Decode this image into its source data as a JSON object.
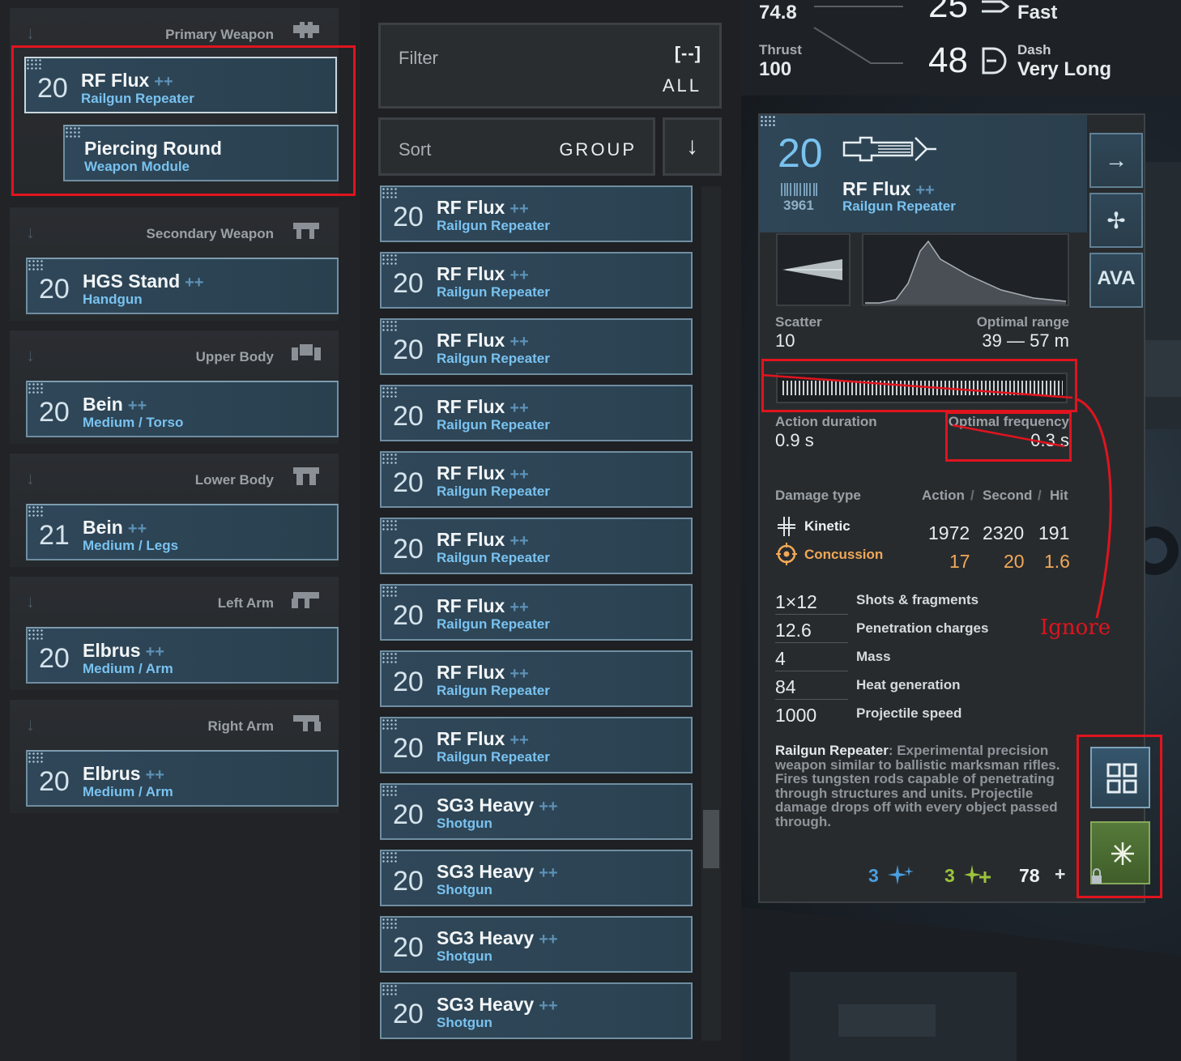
{
  "loadout": [
    {
      "slot": "Primary Weapon",
      "cards": [
        {
          "level": "20",
          "name": "RF Flux",
          "mod": "++",
          "type": "Railgun Repeater"
        },
        {
          "level": "",
          "name": "Piercing Round",
          "mod": "",
          "type": "Weapon Module"
        }
      ]
    },
    {
      "slot": "Secondary Weapon",
      "cards": [
        {
          "level": "20",
          "name": "HGS Stand",
          "mod": "++",
          "type": "Handgun"
        }
      ]
    },
    {
      "slot": "Upper Body",
      "cards": [
        {
          "level": "20",
          "name": "Bein",
          "mod": "++",
          "type": "Medium / Torso"
        }
      ]
    },
    {
      "slot": "Lower Body",
      "cards": [
        {
          "level": "21",
          "name": "Bein",
          "mod": "++",
          "type": "Medium / Legs"
        }
      ]
    },
    {
      "slot": "Left Arm",
      "cards": [
        {
          "level": "20",
          "name": "Elbrus",
          "mod": "++",
          "type": "Medium / Arm"
        }
      ]
    },
    {
      "slot": "Right Arm",
      "cards": [
        {
          "level": "20",
          "name": "Elbrus",
          "mod": "++",
          "type": "Medium / Arm"
        }
      ]
    }
  ],
  "filter": {
    "label": "Filter",
    "icon": "[--]",
    "value": "ALL"
  },
  "sort": {
    "label": "Sort",
    "value": "GROUP",
    "direction_icon": "↓"
  },
  "item_list": [
    {
      "level": "20",
      "name": "RF Flux",
      "mod": "++",
      "type": "Railgun Repeater"
    },
    {
      "level": "20",
      "name": "RF Flux",
      "mod": "++",
      "type": "Railgun Repeater"
    },
    {
      "level": "20",
      "name": "RF Flux",
      "mod": "++",
      "type": "Railgun Repeater"
    },
    {
      "level": "20",
      "name": "RF Flux",
      "mod": "++",
      "type": "Railgun Repeater"
    },
    {
      "level": "20",
      "name": "RF Flux",
      "mod": "++",
      "type": "Railgun Repeater"
    },
    {
      "level": "20",
      "name": "RF Flux",
      "mod": "++",
      "type": "Railgun Repeater"
    },
    {
      "level": "20",
      "name": "RF Flux",
      "mod": "++",
      "type": "Railgun Repeater"
    },
    {
      "level": "20",
      "name": "RF Flux",
      "mod": "++",
      "type": "Railgun Repeater"
    },
    {
      "level": "20",
      "name": "RF Flux",
      "mod": "++",
      "type": "Railgun Repeater"
    },
    {
      "level": "20",
      "name": "SG3 Heavy",
      "mod": "++",
      "type": "Shotgun"
    },
    {
      "level": "20",
      "name": "SG3 Heavy",
      "mod": "++",
      "type": "Shotgun"
    },
    {
      "level": "20",
      "name": "SG3 Heavy",
      "mod": "++",
      "type": "Shotgun"
    },
    {
      "level": "20",
      "name": "SG3 Heavy",
      "mod": "++",
      "type": "Shotgun"
    }
  ],
  "mech_stats": {
    "top_left_value": "74.8",
    "thrust_label": "Thrust",
    "thrust_value": "100",
    "top_big_value": "25",
    "top_big_label": "Fast",
    "dash_big_value": "48",
    "dash_label": "Dash",
    "dash_value": "Very Long"
  },
  "detail": {
    "level": "20",
    "serial": "3961",
    "name": "RF Flux",
    "mod": "++",
    "type": "Railgun Repeater",
    "scatter_label": "Scatter",
    "scatter_value": "10",
    "optimal_range_label": "Optimal range",
    "optimal_range_value": "39 — 57 m",
    "action_duration_label": "Action duration",
    "action_duration_value": "0.9 s",
    "optimal_frequency_label": "Optimal frequency",
    "optimal_frequency_value": "0.3 s",
    "damage": {
      "header_type": "Damage type",
      "header_action": "Action",
      "header_sep1": "/",
      "header_second": "Second",
      "header_sep2": "/",
      "header_hit": "Hit",
      "rows": [
        {
          "type": "Kinetic",
          "action": "1972",
          "second": "2320",
          "hit": "191"
        },
        {
          "type": "Concussion",
          "action": "17",
          "second": "20",
          "hit": "1.6"
        }
      ]
    },
    "properties": [
      {
        "value": "1×12",
        "label": "Shots & fragments"
      },
      {
        "value": "12.6",
        "label": "Penetration charges"
      },
      {
        "value": "4",
        "label": "Mass"
      },
      {
        "value": "84",
        "label": "Heat generation"
      },
      {
        "value": "1000",
        "label": "Projectile speed"
      }
    ],
    "description_name": "Railgun Repeater",
    "description_text": ": Experimental precision weapon similar to ballistic marksman rifles. Fires tungsten rods capable of penetrating through structures and units. Projectile damage drops off with every object passed through.",
    "footer": {
      "blue_count": "3",
      "green_count": "3",
      "total": "78",
      "plus": "+"
    },
    "side_buttons": [
      "arrow-right",
      "crosshair-plus",
      "AVA"
    ]
  },
  "annotation": {
    "ignore_label": "Ignore"
  },
  "colors": {
    "card_bg": "#2f4758",
    "card_border": "#6f8ea1",
    "accent_blue": "#79c2f0",
    "concussion_orange": "#f0a858",
    "annotation_red": "#e0141e",
    "footer_blue": "#4a9fe0",
    "footer_green": "#9bc43a"
  }
}
